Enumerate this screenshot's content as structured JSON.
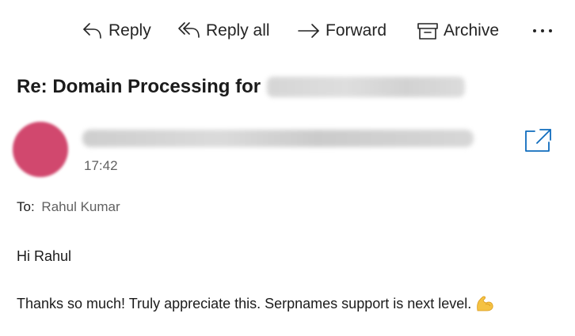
{
  "toolbar": {
    "reply_label": "Reply",
    "reply_all_label": "Reply all",
    "forward_label": "Forward",
    "archive_label": "Archive",
    "more_label": "···"
  },
  "message": {
    "subject": "Re: Domain Processing for",
    "time": "17:42",
    "to_label": "To:",
    "to_name": "Rahul Kumar",
    "greeting": "Hi Rahul",
    "body": "Thanks so much! Truly appreciate this. Serpnames support is next level."
  },
  "icons": {
    "reply": "reply-icon",
    "reply_all": "reply-all-icon",
    "forward": "forward-icon",
    "archive": "archive-icon",
    "more": "more-icon",
    "popout": "open-in-new-window-icon",
    "emoji": "flexed-biceps-emoji"
  },
  "colors": {
    "avatar": "#d1486e",
    "accent": "#0f6cbd",
    "secondary_text": "#616161",
    "emoji": "#f5c242"
  }
}
